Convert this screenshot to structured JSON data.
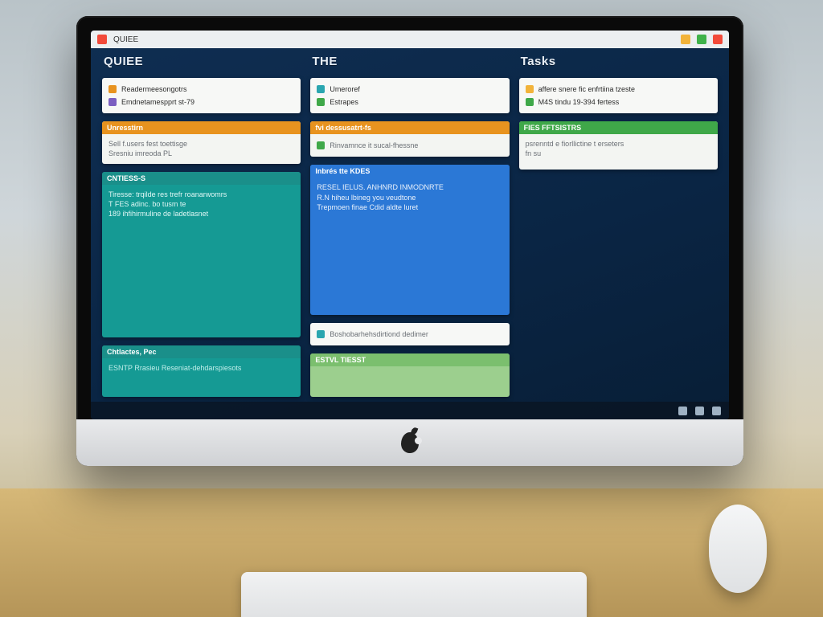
{
  "menubar": {
    "app": "QUIEE"
  },
  "columns": [
    {
      "title": "QUIEE"
    },
    {
      "title": "THE"
    },
    {
      "title": "Tasks"
    }
  ],
  "cards": {
    "c0a": {
      "items": [
        {
          "color": "#e8931f",
          "label": "Readermeesongotrs"
        },
        {
          "color": "#7b5fc1",
          "label": "Emdnetamespprt st-79"
        }
      ]
    },
    "c0b": {
      "header": "Unresstirn",
      "line1": "Sell f.users fest toettisge",
      "line2": "Sresniu imreoda PL"
    },
    "c0c": {
      "header": "CNTIESS-S",
      "l1": "Tiresse: trqilde res trefr roanarwomrs",
      "l2": "T FES adinc. bo tusm te",
      "l3": "189 ihfihirmuline de ladetlasnet"
    },
    "c0d": {
      "header": "Chtlactes, Pec",
      "line": "ESNTP Rrasieu Reseniat-dehdarspiesots"
    },
    "c1a": {
      "items": [
        {
          "color": "#2aa6b0",
          "label": "Umeroref"
        },
        {
          "color": "#3fa849",
          "label": "Estrapes"
        }
      ]
    },
    "c1b": {
      "header": "fvi dessusatrt-fs",
      "line": "Rinvamnce it sucal-fhessne"
    },
    "c1c": {
      "header": "Inbrés tte KDES",
      "l1": "RESEL IELUS. ANHNRD INMODNRTE",
      "l2": "R.N hiheu lbineg you veudtone",
      "l3": "Trepmoen finae Cdid aldte luret"
    },
    "c1d": {
      "line": "Boshobarhehsdirtiond dedimer"
    },
    "c1e": {
      "header": "ESTVL TIESST"
    },
    "c2a": {
      "items": [
        {
          "color": "#f2b33a",
          "label": "affere snere fic enfrtiina tzeste"
        },
        {
          "color": "#3fa849",
          "label": "M4S tindu 19-394 fertess"
        }
      ]
    },
    "c2b": {
      "header": "FIES FFTSISTRS",
      "l1": "psrenntd e fiorllictine t erseters",
      "l2": "fn su"
    }
  },
  "colors": {
    "orange": "#e8931f",
    "teal": "#159a94",
    "green": "#3fa849",
    "blue": "#2b78d6",
    "ltgreen": "#9ccf8e"
  }
}
